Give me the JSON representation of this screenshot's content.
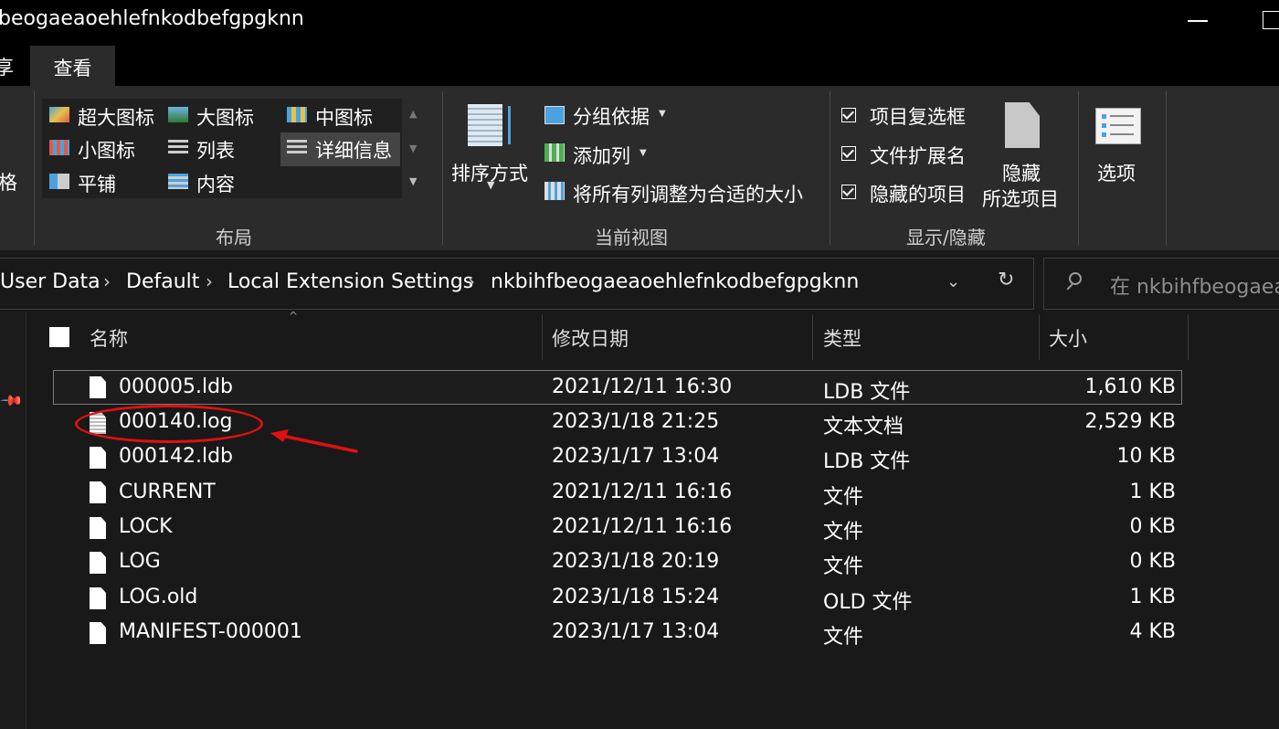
{
  "window": {
    "title": "beogaeaoehlefnkodbefgpgknn",
    "minimize_icon": "minimize-icon",
    "maximize_icon": "maximize-icon"
  },
  "tabs": {
    "share_partial": "享",
    "view": "查看"
  },
  "ribbon": {
    "pane_partial": "格",
    "layout": {
      "group_label": "布局",
      "items": [
        "超大图标",
        "大图标",
        "中图标",
        "小图标",
        "列表",
        "详细信息",
        "平铺",
        "内容"
      ],
      "selected": "详细信息"
    },
    "current_view": {
      "group_label": "当前视图",
      "sort_by": "排序方式",
      "group_by": "分组依据",
      "add_column": "添加列",
      "size_all_columns": "将所有列调整为合适的大小"
    },
    "show_hide": {
      "group_label": "显示/隐藏",
      "item_checkboxes": "项目复选框",
      "file_extensions": "文件扩展名",
      "hidden_items": "隐藏的项目",
      "hide_selected_line1": "隐藏",
      "hide_selected_line2": "所选项目",
      "checked": [
        true,
        true,
        true
      ]
    },
    "options": "选项"
  },
  "address": {
    "crumbs": [
      "User Data",
      "Default",
      "Local Extension Settings",
      "nkbihfbeogaeaoehlefnkodbefgpgknn"
    ],
    "search_placeholder": "在 nkbihfbeogaea"
  },
  "columns": {
    "name": "名称",
    "modified": "修改日期",
    "type": "类型",
    "size": "大小"
  },
  "files": [
    {
      "name": "000005.ldb",
      "modified": "2021/12/11 16:30",
      "type": "LDB 文件",
      "size": "1,610 KB"
    },
    {
      "name": "000140.log",
      "modified": "2023/1/18 21:25",
      "type": "文本文档",
      "size": "2,529 KB"
    },
    {
      "name": "000142.ldb",
      "modified": "2023/1/17 13:04",
      "type": "LDB 文件",
      "size": "10 KB"
    },
    {
      "name": "CURRENT",
      "modified": "2021/12/11 16:16",
      "type": "文件",
      "size": "1 KB"
    },
    {
      "name": "LOCK",
      "modified": "2021/12/11 16:16",
      "type": "文件",
      "size": "0 KB"
    },
    {
      "name": "LOG",
      "modified": "2023/1/18 20:19",
      "type": "文件",
      "size": "0 KB"
    },
    {
      "name": "LOG.old",
      "modified": "2023/1/18 15:24",
      "type": "OLD 文件",
      "size": "1 KB"
    },
    {
      "name": "MANIFEST-000001",
      "modified": "2023/1/17 13:04",
      "type": "文件",
      "size": "4 KB"
    }
  ],
  "colors": {
    "annotation": "#e01010",
    "background": "#191919",
    "ribbon": "#2b2b2b"
  }
}
